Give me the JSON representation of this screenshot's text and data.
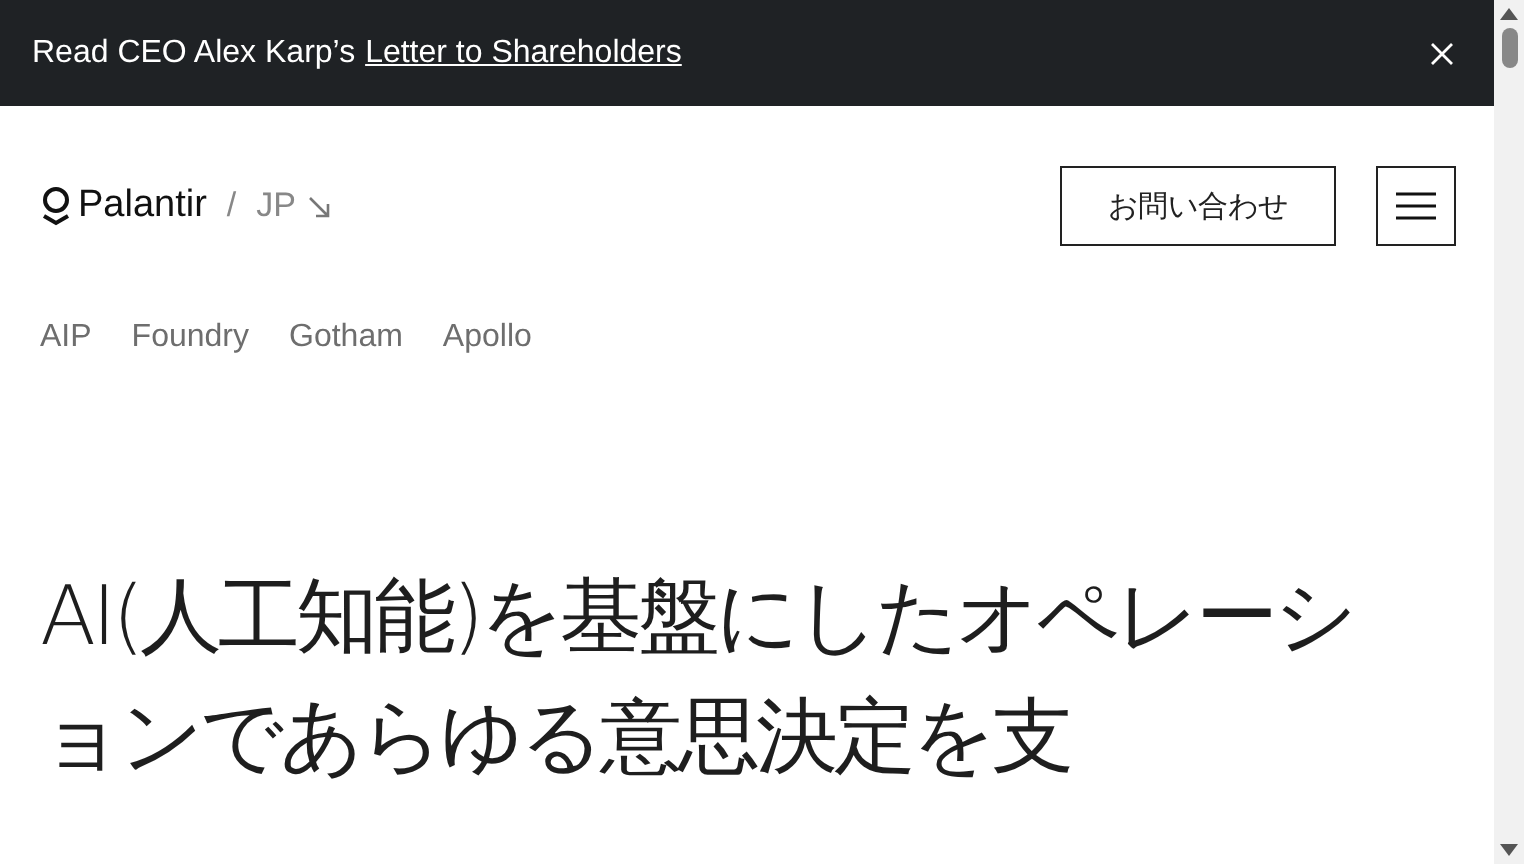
{
  "banner": {
    "text": "Read CEO Alex Karp’s",
    "link": "Letter to Shareholders"
  },
  "header": {
    "logo": "Palantir",
    "separator": "/",
    "region": "JP",
    "contact_button": "お問い合わせ"
  },
  "nav": [
    {
      "label": "AIP"
    },
    {
      "label": "Foundry"
    },
    {
      "label": "Gotham"
    },
    {
      "label": "Apollo"
    }
  ],
  "hero": {
    "headline": "AI(人工知能)を基盤にしたオペレーションであらゆる意思決定を支"
  }
}
